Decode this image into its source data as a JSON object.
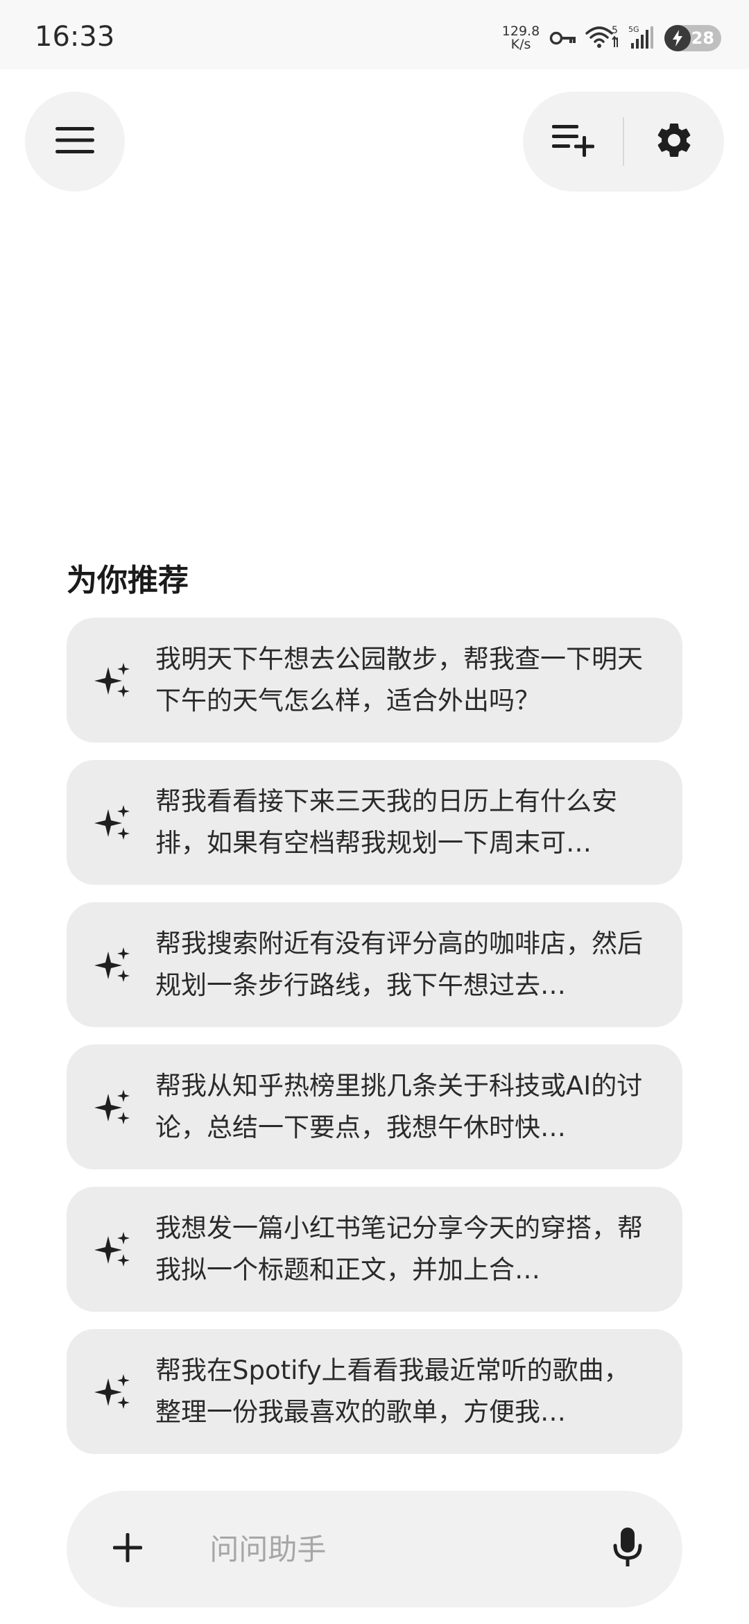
{
  "status_bar": {
    "time": "16:33",
    "net_speed_value": "129.8",
    "net_speed_unit": "K/s",
    "wifi_label": "5",
    "cell_label": "5G",
    "battery_level": "28",
    "icons": [
      "vpn-key-icon",
      "wifi-icon",
      "cellular-signal-icon",
      "battery-charging-icon"
    ]
  },
  "header": {
    "icons": [
      "menu-icon",
      "new-chat-icon",
      "settings-icon"
    ]
  },
  "recommendations": {
    "title": "为你推荐",
    "items": [
      {
        "text": "我明天下午想去公园散步，帮我查一下明天下午的天气怎么样，适合外出吗？"
      },
      {
        "text": "帮我看看接下来三天我的日历上有什么安排，如果有空档帮我规划一下周末可…"
      },
      {
        "text": "帮我搜索附近有没有评分高的咖啡店，然后规划一条步行路线，我下午想过去…"
      },
      {
        "text": "帮我从知乎热榜里挑几条关于科技或AI的讨论，总结一下要点，我想午休时快…"
      },
      {
        "text": "我想发一篇小红书笔记分享今天的穿搭，帮我拟一个标题和正文，并加上合…"
      },
      {
        "text": "帮我在Spotify上看看我最近常听的歌曲，整理一份我最喜欢的歌单，方便我…"
      }
    ]
  },
  "input": {
    "placeholder": "问问助手",
    "value": ""
  },
  "colors": {
    "background": "#ffffff",
    "card": "#ececec",
    "button_bg": "#f2f2f2",
    "text": "#1f1f1f",
    "placeholder": "#a6a6a6"
  }
}
